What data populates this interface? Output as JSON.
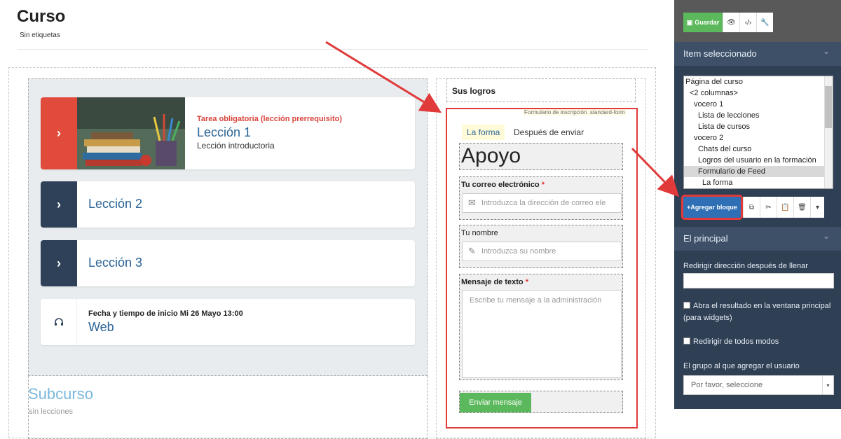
{
  "page": {
    "title": "Curso",
    "tags": "Sin etiquetas"
  },
  "lessons": [
    {
      "kicker": "Tarea obligatoria (lección prerrequisito)",
      "title": "Lección 1",
      "subtitle": "Lección introductoria",
      "arrow_color": "#e04b3c"
    },
    {
      "title": "Lección 2",
      "arrow_color": "#2e4159"
    },
    {
      "title": "Lección 3",
      "arrow_color": "#2e4159"
    },
    {
      "kicker": "Fecha y tiempo de inicio Mi 26 Mayo 13:00",
      "title": "Web"
    }
  ],
  "subcourse": {
    "title": "Subcurso",
    "subtitle": "sin lecciones"
  },
  "right_column": {
    "logros_title": "Sus logros",
    "form_caption": "Formulario de inscripción .standard-form",
    "tabs": [
      "La forma",
      "Después de enviar"
    ],
    "heading": "Apoyo",
    "email_label": "Tu correo electrónico",
    "email_placeholder": "Introduzca la dirección de correo ele",
    "name_label": "Tu nombre",
    "name_placeholder": "Introduzca su nombre",
    "message_label": "Mensaje de texto",
    "message_placeholder": "Escribe tu mensaje a la administración",
    "required_mark": "*",
    "submit_label": "Enviar mensaje"
  },
  "editor_panel": {
    "save_label": "Guardar",
    "selected_section_title": "Item seleccionado",
    "tree": [
      "Página del curso",
      "<2 columnas>",
      "vocero 1",
      "Lista de lecciones",
      "Lista de cursos",
      "vocero 2",
      "Chats del curso",
      "Logros del usuario en la formación",
      "Formulario de Feed",
      "La forma"
    ],
    "add_block_label": "+Agregar bloque",
    "main_section_title": "El principal",
    "redirect_label": "Redirigir dirección después de llenar",
    "redirect_value": "",
    "open_result_label": "Abra el resultado en la ventana principal (para widgets)",
    "redirect_always_label": "Redirigir de todos modos",
    "group_label": "El grupo al que agregar el usuario",
    "group_select_value": "Por favor, seleccione"
  },
  "colors": {
    "accent_red": "#e03a3a",
    "primary_blue": "#2e6fb5",
    "success_green": "#5cb85c",
    "panel_dark": "#2f3f54"
  }
}
